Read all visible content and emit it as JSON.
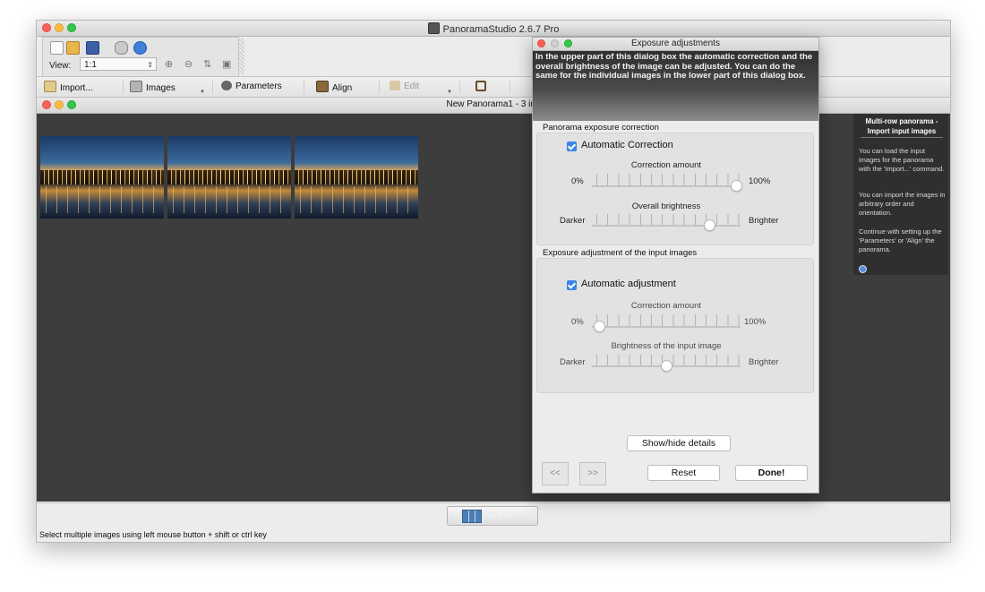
{
  "app": {
    "title": "PanoramaStudio 2.6.7 Pro"
  },
  "toolbar": {
    "view_label": "View:",
    "view_value": "1:1"
  },
  "main_toolbar": {
    "import_label": "Import...",
    "images_label": "Images",
    "parameters_label": "Parameters",
    "align_label": "Align",
    "edit_label": "Edit"
  },
  "document": {
    "title": "New Panorama1 - 3 inp"
  },
  "help_panel": {
    "heading": "Multi-row panorama - Import input images",
    "para1": "You can load the input images for the panorama with the 'Import...' command.",
    "para2": "You can import the images in arbitrary order and orientation.",
    "para3": "Continue with setting up the 'Parameters' or 'Align' the panorama."
  },
  "bottom": {
    "input_button_label": "Input im...",
    "status_text": "Select multiple images using left mouse button + shift or ctrl key"
  },
  "dialog": {
    "title": "Exposure adjustments",
    "description": "In the upper part of this dialog box the automatic correction and the overall brightness of the image can be adjusted. You can do the same for the individual images in the lower part of this dialog box.",
    "panorama_group": {
      "label": "Panorama exposure correction",
      "auto_checkbox_label": "Automatic Correction",
      "auto_checked": true,
      "correction_label": "Correction amount",
      "correction_min": "0%",
      "correction_max": "100%",
      "correction_value_fraction": 0.97,
      "brightness_label": "Overall brightness",
      "brightness_min": "Darker",
      "brightness_max": "Brighter",
      "brightness_value_fraction": 0.79
    },
    "images_group": {
      "label": "Exposure adjustment of the input images",
      "auto_checkbox_label": "Automatic adjustment",
      "auto_checked": true,
      "correction_label": "Correction amount",
      "correction_min": "0%",
      "correction_max": "100%",
      "correction_value_fraction": 0.05,
      "brightness_label": "Brightness of the input image",
      "brightness_min": "Darker",
      "brightness_max": "Brighter",
      "brightness_value_fraction": 0.5
    },
    "show_hide_label": "Show/hide details",
    "prev_label": "<<",
    "next_label": ">>",
    "reset_label": "Reset",
    "done_label": "Done!"
  }
}
